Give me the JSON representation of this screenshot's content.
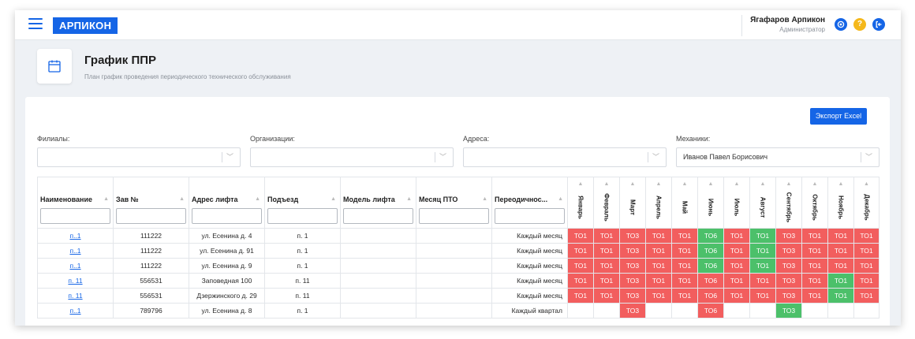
{
  "app": {
    "logo": "АРПИКОН",
    "menu_icon": "hamburger-icon"
  },
  "user": {
    "name": "Ягафаров Арпикон",
    "role": "Администратор"
  },
  "topbar_icons": [
    "settings-icon",
    "help-icon",
    "logout-icon"
  ],
  "help_glyph": "?",
  "page": {
    "title": "График ППР",
    "subtitle": "План график проведения периодического технического обслуживания",
    "icon": "calendar-icon"
  },
  "export_label": "Экспорт Excel",
  "filters": [
    {
      "label": "Филиалы:",
      "value": ""
    },
    {
      "label": "Организации:",
      "value": ""
    },
    {
      "label": "Адреса:",
      "value": ""
    },
    {
      "label": "Механики:",
      "value": "Иванов Павел Борисович"
    }
  ],
  "columns": [
    "Наименование",
    "Зав №",
    "Адрес лифта",
    "Подъезд",
    "Модель лифта",
    "Месяц ПТО",
    "Переодичнос..."
  ],
  "months": [
    "Январь",
    "Февраль",
    "Март",
    "Апрель",
    "Май",
    "Июнь",
    "Июль",
    "Август",
    "Сентябрь",
    "Октябрь",
    "Ноябрь",
    "Декабрь"
  ],
  "rows": [
    {
      "name": "п..1",
      "zav": "111222",
      "addr": "ул. Есенина д. 4",
      "entrance": "п. 1",
      "model": "",
      "pto": "",
      "period": "Каждый месяц",
      "cells": [
        [
          "ТО1",
          "r"
        ],
        [
          "ТО1",
          "r"
        ],
        [
          "ТО3",
          "r"
        ],
        [
          "ТО1",
          "r"
        ],
        [
          "ТО1",
          "r"
        ],
        [
          "ТО6",
          "g"
        ],
        [
          "ТО1",
          "r"
        ],
        [
          "ТО1",
          "g"
        ],
        [
          "ТО3",
          "r"
        ],
        [
          "ТО1",
          "r"
        ],
        [
          "ТО1",
          "r"
        ],
        [
          "ТО1",
          "r"
        ]
      ]
    },
    {
      "name": "п..1",
      "zav": "111222",
      "addr": "ул. Есенина д. 91",
      "entrance": "п. 1",
      "model": "",
      "pto": "",
      "period": "Каждый месяц",
      "cells": [
        [
          "ТО1",
          "r"
        ],
        [
          "ТО1",
          "r"
        ],
        [
          "ТО3",
          "r"
        ],
        [
          "ТО1",
          "r"
        ],
        [
          "ТО1",
          "r"
        ],
        [
          "ТО6",
          "g"
        ],
        [
          "ТО1",
          "r"
        ],
        [
          "ТО1",
          "g"
        ],
        [
          "ТО3",
          "r"
        ],
        [
          "ТО1",
          "r"
        ],
        [
          "ТО1",
          "r"
        ],
        [
          "ТО1",
          "r"
        ]
      ]
    },
    {
      "name": "п..1",
      "zav": "111222",
      "addr": "ул. Есенина д. 9",
      "entrance": "п. 1",
      "model": "",
      "pto": "",
      "period": "Каждый месяц",
      "cells": [
        [
          "ТО1",
          "r"
        ],
        [
          "ТО1",
          "r"
        ],
        [
          "ТО3",
          "r"
        ],
        [
          "ТО1",
          "r"
        ],
        [
          "ТО1",
          "r"
        ],
        [
          "ТО6",
          "g"
        ],
        [
          "ТО1",
          "r"
        ],
        [
          "ТО1",
          "g"
        ],
        [
          "ТО3",
          "r"
        ],
        [
          "ТО1",
          "r"
        ],
        [
          "ТО1",
          "r"
        ],
        [
          "ТО1",
          "r"
        ]
      ]
    },
    {
      "name": "п. 11",
      "zav": "556531",
      "addr": "Заповедная 100",
      "entrance": "п. 11",
      "model": "",
      "pto": "",
      "period": "Каждый месяц",
      "cells": [
        [
          "ТО1",
          "r"
        ],
        [
          "ТО1",
          "r"
        ],
        [
          "ТО3",
          "r"
        ],
        [
          "ТО1",
          "r"
        ],
        [
          "ТО1",
          "r"
        ],
        [
          "ТО6",
          "r"
        ],
        [
          "ТО1",
          "r"
        ],
        [
          "ТО1",
          "r"
        ],
        [
          "ТО3",
          "r"
        ],
        [
          "ТО1",
          "r"
        ],
        [
          "ТО1",
          "g"
        ],
        [
          "ТО1",
          "r"
        ]
      ]
    },
    {
      "name": "п. 11",
      "zav": "556531",
      "addr": "Дзержинского д. 29",
      "entrance": "п. 11",
      "model": "",
      "pto": "",
      "period": "Каждый месяц",
      "cells": [
        [
          "ТО1",
          "r"
        ],
        [
          "ТО1",
          "r"
        ],
        [
          "ТО3",
          "r"
        ],
        [
          "ТО1",
          "r"
        ],
        [
          "ТО1",
          "r"
        ],
        [
          "ТО6",
          "r"
        ],
        [
          "ТО1",
          "r"
        ],
        [
          "ТО1",
          "r"
        ],
        [
          "ТО3",
          "r"
        ],
        [
          "ТО1",
          "r"
        ],
        [
          "ТО1",
          "g"
        ],
        [
          "ТО1",
          "r"
        ]
      ]
    },
    {
      "name": "п..1",
      "zav": "789796",
      "addr": "ул. Есенина д. 8",
      "entrance": "п. 1",
      "model": "",
      "pto": "",
      "period": "Каждый квартал",
      "cells": [
        [
          "",
          ""
        ],
        [
          "",
          ""
        ],
        [
          "ТО3",
          "r"
        ],
        [
          "",
          ""
        ],
        [
          "",
          ""
        ],
        [
          "ТО6",
          "r"
        ],
        [
          "",
          ""
        ],
        [
          "",
          ""
        ],
        [
          "ТО3",
          "g"
        ],
        [
          "",
          ""
        ],
        [
          "",
          ""
        ],
        [
          "",
          ""
        ]
      ]
    }
  ]
}
